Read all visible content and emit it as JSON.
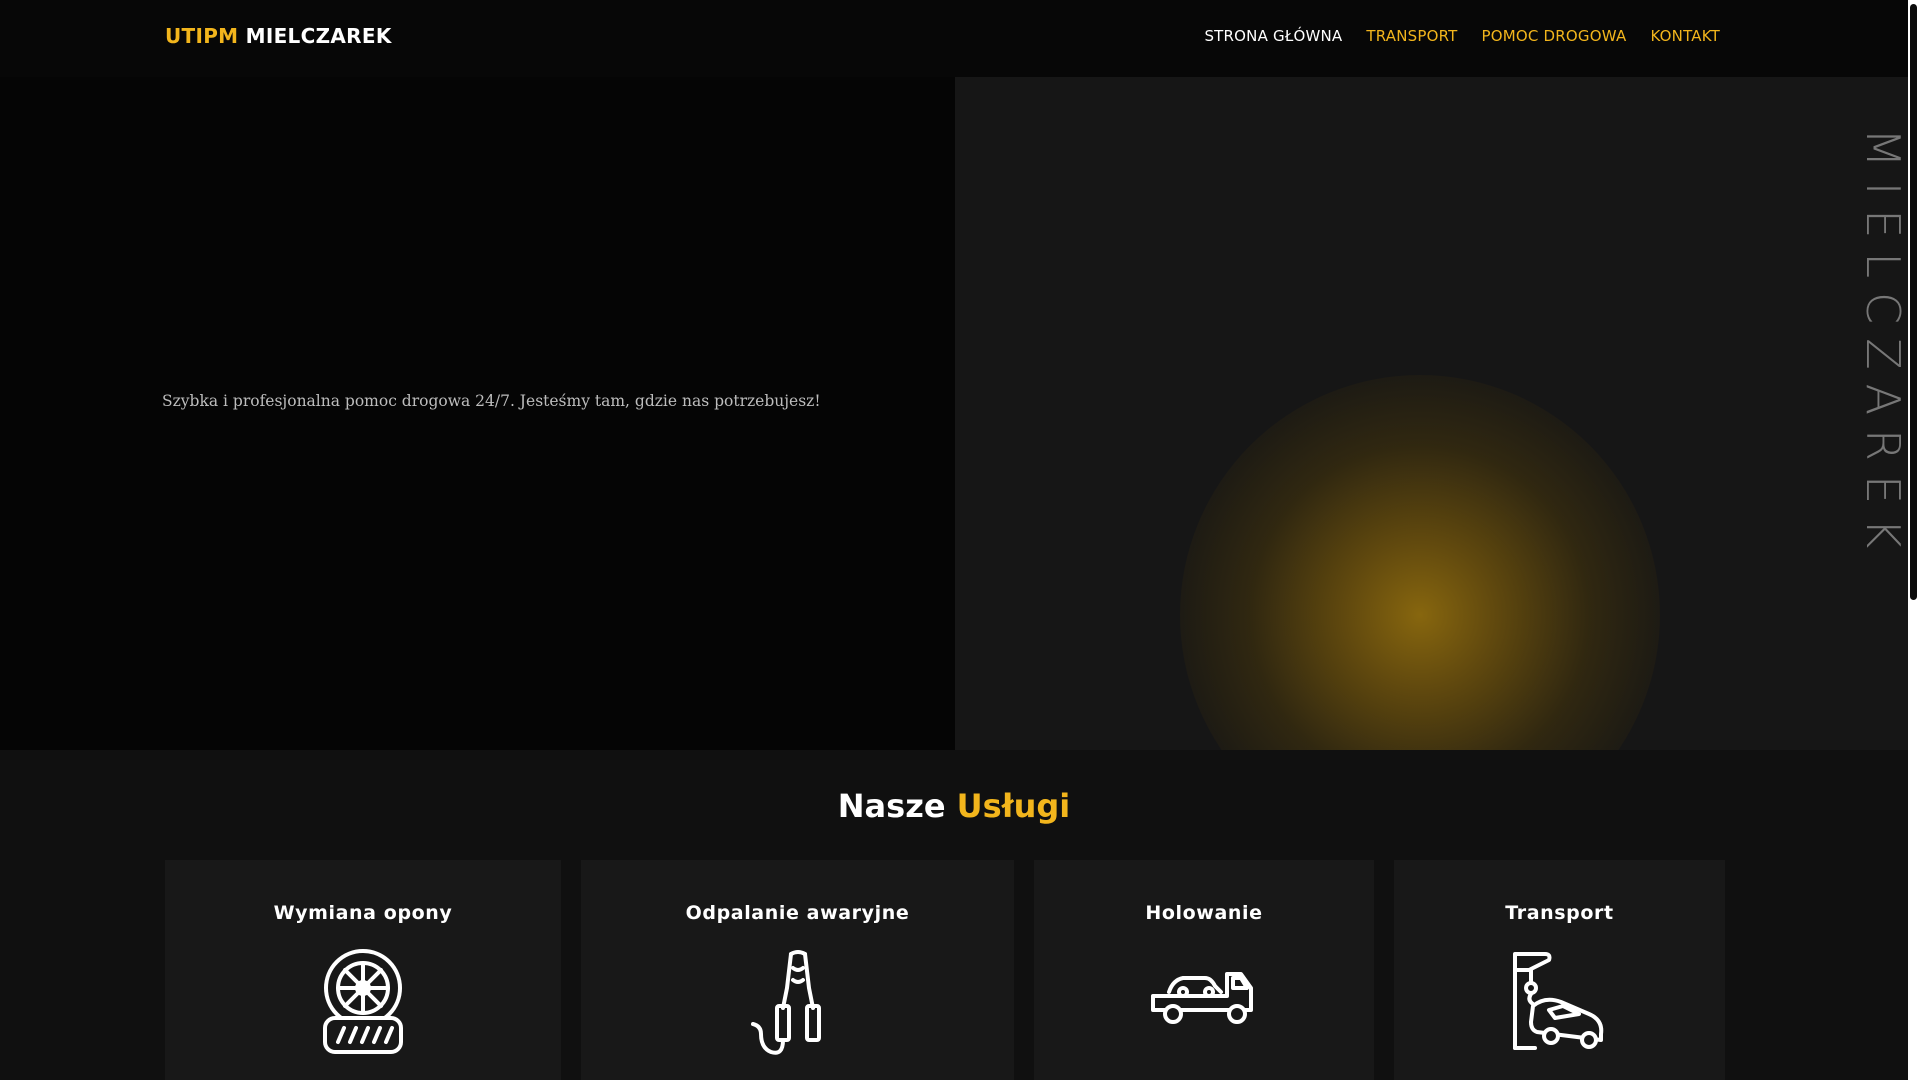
{
  "brand": {
    "accent": "UTIPM",
    "rest": "MIELCZAREK"
  },
  "nav": {
    "items": [
      {
        "label": "STRONA GŁÓWNA",
        "active": true
      },
      {
        "label": "TRANSPORT",
        "active": false
      },
      {
        "label": "POMOC DROGOWA",
        "active": false
      },
      {
        "label": "KONTAKT",
        "active": false
      }
    ]
  },
  "hero": {
    "tagline": "Szybka i profesjonalna pomoc drogowa 24/7. Jesteśmy tam, gdzie nas potrzebujesz!",
    "vertical_word": "MIELCZAREK"
  },
  "services": {
    "title_white": "Nasze",
    "title_yellow": "Usługi",
    "cards": [
      {
        "title": "Wymiana opony",
        "icon": "tire-icon"
      },
      {
        "title": "Odpalanie awaryjne",
        "icon": "jumper-cables-icon"
      },
      {
        "title": "Holowanie",
        "icon": "tow-truck-icon"
      },
      {
        "title": "Transport",
        "icon": "crane-car-icon"
      }
    ]
  },
  "colors": {
    "accent": "#f2b51c",
    "background": "#070707",
    "panel": "#161616",
    "card": "#181818"
  }
}
